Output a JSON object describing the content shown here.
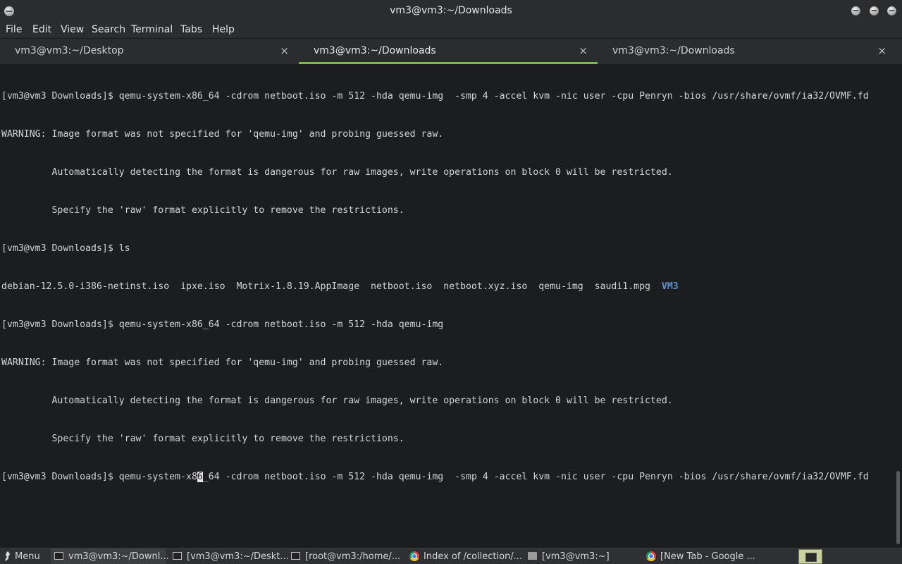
{
  "window": {
    "title": "vm3@vm3:~/Downloads"
  },
  "menubar": {
    "items": [
      "File",
      "Edit",
      "View",
      "Search",
      "Terminal",
      "Tabs",
      "Help"
    ]
  },
  "tabs": [
    {
      "label": "vm3@vm3:~/Desktop",
      "close": "×",
      "active": false
    },
    {
      "label": "vm3@vm3:~/Downloads",
      "close": "×",
      "active": true
    },
    {
      "label": "vm3@vm3:~/Downloads",
      "close": "×",
      "active": false
    }
  ],
  "terminal": {
    "lines": [
      "[vm3@vm3 Downloads]$ qemu-system-x86_64 -cdrom netboot.iso -m 512 -hda qemu-img  -smp 4 -accel kvm -nic user -cpu Penryn -bios /usr/share/ovmf/ia32/OVMF.fd",
      "WARNING: Image format was not specified for 'qemu-img' and probing guessed raw.",
      "         Automatically detecting the format is dangerous for raw images, write operations on block 0 will be restricted.",
      "         Specify the 'raw' format explicitly to remove the restrictions.",
      "[vm3@vm3 Downloads]$ ls"
    ],
    "ls_output": "debian-12.5.0-i386-netinst.iso  ipxe.iso  Motrix-1.8.19.AppImage  netboot.iso  netboot.xyz.iso  qemu-img  saudi1.mpg  ",
    "ls_dir": "VM3",
    "lines2": [
      "[vm3@vm3 Downloads]$ qemu-system-x86_64 -cdrom netboot.iso -m 512 -hda qemu-img",
      "WARNING: Image format was not specified for 'qemu-img' and probing guessed raw.",
      "         Automatically detecting the format is dangerous for raw images, write operations on block 0 will be restricted.",
      "         Specify the 'raw' format explicitly to remove the restrictions."
    ],
    "current_before_cursor": "[vm3@vm3 Downloads]$ qemu-system-x8",
    "cursor_char": "6",
    "current_after_cursor": "_64 -cdrom netboot.iso -m 512 -hda qemu-img  -smp 4 -accel kvm -nic user -cpu Penryn -bios /usr/share/ovmf/ia32/OVMF.fd"
  },
  "taskbar": {
    "menu_label": "Menu",
    "tasks": [
      {
        "label": "vm3@vm3:~/Downl...",
        "icon": "terminal-icon",
        "active": true
      },
      {
        "label": "[vm3@vm3:~/Deskt...",
        "icon": "terminal-icon",
        "active": false
      },
      {
        "label": "[root@vm3:/home/...",
        "icon": "terminal-icon",
        "active": false
      },
      {
        "label": "Index of /collection/...",
        "icon": "chrome-icon",
        "active": false
      },
      {
        "label": "[vm3@vm3:~]",
        "icon": "folder-icon",
        "active": false
      },
      {
        "label": "[New Tab - Google ...",
        "icon": "chrome-icon",
        "active": false
      }
    ]
  },
  "colors": {
    "accent_tab": "#7cbb45",
    "directory": "#5e8fcf",
    "background": "#1c1d1f"
  }
}
